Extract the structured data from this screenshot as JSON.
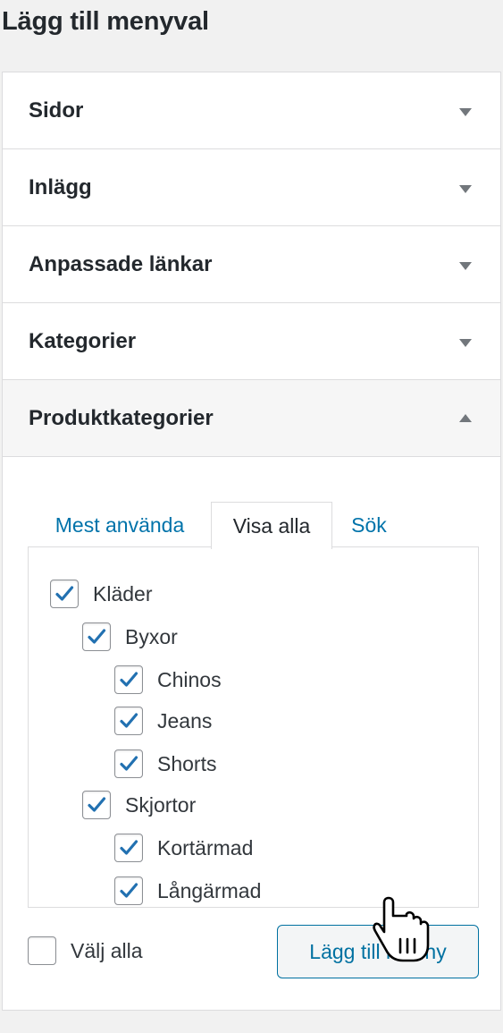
{
  "header": {
    "title": "Lägg till menyval"
  },
  "accordion": [
    {
      "label": "Sidor",
      "open": false
    },
    {
      "label": "Inlägg",
      "open": false
    },
    {
      "label": "Anpassade länkar",
      "open": false
    },
    {
      "label": "Kategorier",
      "open": false
    },
    {
      "label": "Produktkategorier",
      "open": true
    }
  ],
  "tabs": [
    {
      "label": "Mest använda",
      "active": false
    },
    {
      "label": "Visa alla",
      "active": true
    },
    {
      "label": "Sök",
      "active": false
    }
  ],
  "categories": [
    {
      "label": "Kläder",
      "level": 0,
      "checked": true
    },
    {
      "label": "Byxor",
      "level": 1,
      "checked": true
    },
    {
      "label": "Chinos",
      "level": 2,
      "checked": true
    },
    {
      "label": "Jeans",
      "level": 2,
      "checked": true
    },
    {
      "label": "Shorts",
      "level": 2,
      "checked": true
    },
    {
      "label": "Skjortor",
      "level": 1,
      "checked": true
    },
    {
      "label": "Kortärmad",
      "level": 2,
      "checked": true
    },
    {
      "label": "Långärmad",
      "level": 2,
      "checked": true
    }
  ],
  "footer": {
    "select_all_label": "Välj alla",
    "select_all_checked": false,
    "add_button_label": "Lägg till i meny"
  },
  "colors": {
    "accent": "#0073aa",
    "check": "#2271b1",
    "border": "#dcdcde",
    "background": "#f1f1f1"
  },
  "icons": {
    "collapsed": "caret-down-icon",
    "expanded": "caret-up-icon",
    "checkbox": "checkmark-icon",
    "pointer": "hand-pointer-icon"
  }
}
